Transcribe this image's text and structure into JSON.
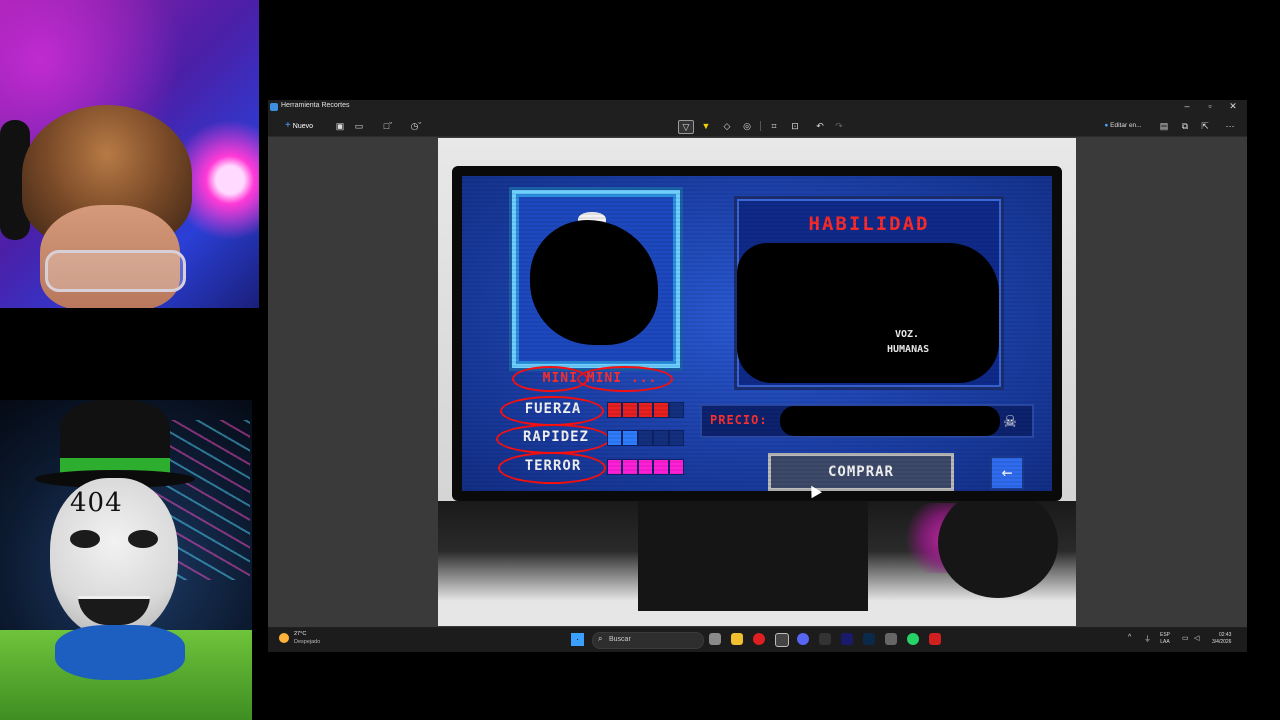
{
  "window": {
    "title": "Herramienta Recortes",
    "controls": {
      "minimize": "–",
      "maximize": "▫",
      "close": "✕"
    }
  },
  "toolbar": {
    "new_label": "Nuevo",
    "edit_label": "Editar en...",
    "icons": [
      "camera-icon",
      "video-icon",
      "rectangle-mode-icon",
      "delay-icon",
      "pen-icon",
      "highlighter-icon",
      "eraser-icon",
      "shapes-icon",
      "crop-icon",
      "ocr-icon",
      "undo-icon",
      "redo-icon",
      "copilot-icon",
      "save-icon",
      "copy-icon",
      "share-icon",
      "more-icon"
    ]
  },
  "game": {
    "name_label": "MINI MINI ...",
    "stats": [
      {
        "label": "FUERZA",
        "level": 4,
        "max": 5,
        "color": "#e82020"
      },
      {
        "label": "RAPIDEZ",
        "level": 2,
        "max": 5,
        "color": "#2f7dff"
      },
      {
        "label": "TERROR",
        "level": 5,
        "max": 5,
        "color": "#ff1fd8"
      }
    ],
    "ability_title": "HABILIDAD",
    "ability_text_line1": "VOZ.",
    "ability_text_line2": "HUMANAS",
    "price_label": "PRECIO:",
    "buy_label": "COMPRAR",
    "back_arrow": "←",
    "skull": "☠"
  },
  "overlay": {
    "cam_bottom_text": "404"
  },
  "taskbar": {
    "weather_temp": "27°C",
    "weather_desc": "Despejado",
    "search_placeholder": "Buscar",
    "lang_line1": "ESP",
    "lang_line2": "LAA",
    "time": "02:43",
    "date": "3/4/2026",
    "colors": {
      "accent": "#3aa0ff"
    }
  }
}
